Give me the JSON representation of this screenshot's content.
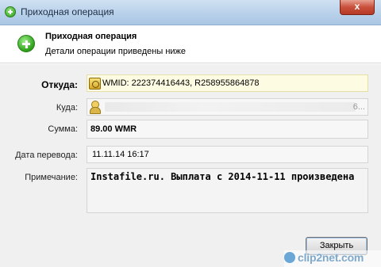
{
  "window": {
    "title": "Приходная операция",
    "close_glyph": "x"
  },
  "header": {
    "title": "Приходная операция",
    "subtitle": "Детали операции приведены ниже",
    "icon": "add-green-circle-icon"
  },
  "fields": {
    "from_label": "Откуда:",
    "from_value": "WMID: 222374416443, R258955864878",
    "to_label": "Куда:",
    "to_trailing": "6...",
    "sum_label": "Сумма:",
    "sum_value": "89.00 WMR",
    "date_label": "Дата перевода:",
    "date_value": "11.11.14 16:17",
    "note_label": "Примечание:",
    "note_value": "Instafile.ru. Выплата с 2014-11-11 произведена"
  },
  "buttons": {
    "close_label": "Закрыть"
  },
  "watermark": {
    "text": "clip2net.com"
  },
  "colors": {
    "titlebar": "#b9d1ea",
    "from_field_bg": "#fdfbe2",
    "body_bg": "#f0f0f0",
    "close_btn": "#c9503b"
  }
}
